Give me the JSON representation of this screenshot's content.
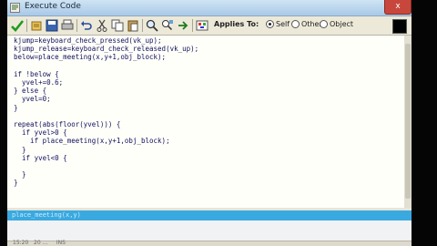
{
  "window": {
    "title": "Execute Code",
    "close_label": "x"
  },
  "toolbar": {
    "buttons": [
      "ok-check-icon",
      "load-icon",
      "save-icon",
      "print-icon",
      "undo-icon",
      "cut-icon",
      "copy-icon",
      "paste-icon",
      "search-icon",
      "replace-icon",
      "goto-icon",
      "color-icon",
      "check-syntax-icon"
    ],
    "applies_to_label": "Applies To:",
    "radio_self": "Self",
    "radio_other": "Other",
    "radio_object": "Object",
    "selected_radio": "Self"
  },
  "editor": {
    "code": "kjump=keyboard_check_pressed(vk_up);\nkjump_release=keyboard_check_released(vk_up);\nbelow=place_meeting(x,y+1,obj_block);\n\nif !below {\n  yvel+=0.6;\n} else {\n  yvel=0;\n}\n\nrepeat(abs(floor(yvel))) {\n  if yvel>0 {\n    if place_meeting(x,y+1,obj_block);\n  }\n  if yvel<0 {\n\n  }\n}",
    "highlight_text": "place_meeting(x,y)"
  },
  "status": {
    "text": "15:20   20 ...     INS"
  },
  "colors": {
    "code_text": "#101060",
    "highlight_bar": "#3aa9df",
    "editor_bg": "#fffff9"
  }
}
